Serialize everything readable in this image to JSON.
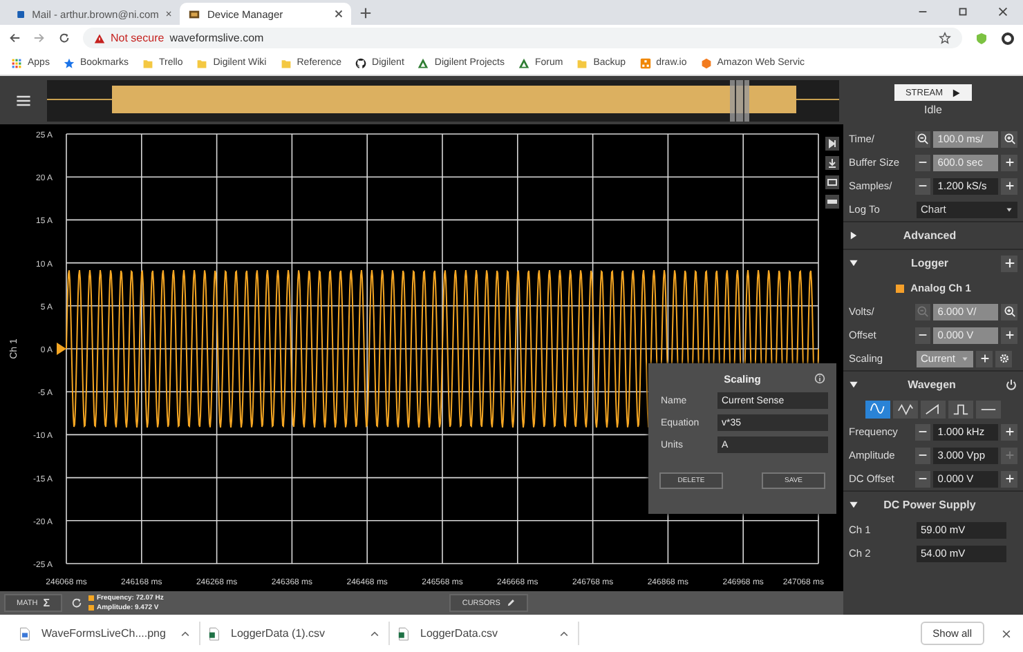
{
  "browser": {
    "tabs": [
      {
        "title": "Mail - arthur.brown@ni.com",
        "selected": false
      },
      {
        "title": "Device Manager",
        "selected": true
      }
    ],
    "address": {
      "warning": "Not secure",
      "url": "waveformslive.com"
    },
    "bookmarks": [
      {
        "kind": "apps",
        "label": "Apps"
      },
      {
        "kind": "star",
        "label": "Bookmarks"
      },
      {
        "kind": "folder",
        "label": "Trello"
      },
      {
        "kind": "folder",
        "label": "Digilent Wiki"
      },
      {
        "kind": "folder",
        "label": "Reference"
      },
      {
        "kind": "github",
        "label": "Digilent"
      },
      {
        "kind": "triangle",
        "label": "Digilent Projects"
      },
      {
        "kind": "triangle",
        "label": "Forum"
      },
      {
        "kind": "folder",
        "label": "Backup"
      },
      {
        "kind": "drawio",
        "label": "draw.io"
      },
      {
        "kind": "aws",
        "label": "Amazon Web Servic"
      }
    ],
    "downloads": [
      {
        "kind": "image",
        "name": "WaveFormsLiveCh....png"
      },
      {
        "kind": "sheet",
        "name": "LoggerData (1).csv"
      },
      {
        "kind": "sheet",
        "name": "LoggerData.csv"
      }
    ],
    "show_all": "Show all"
  },
  "chart": {
    "channel_label": "Ch 1",
    "y_ticks": [
      "25 A",
      "20 A",
      "15 A",
      "10 A",
      "5 A",
      "0 A",
      "-5 A",
      "-10 A",
      "-15 A",
      "-20 A",
      "-25 A"
    ],
    "x_ticks": [
      "246068 ms",
      "246168 ms",
      "246268 ms",
      "246368 ms",
      "246468 ms",
      "246568 ms",
      "246668 ms",
      "246768 ms",
      "246868 ms",
      "246968 ms",
      "247068 ms"
    ]
  },
  "status_bar": {
    "math": "MATH",
    "math_symbol": "Σ",
    "frequency": "Frequency: 72.07 Hz",
    "amplitude": "Amplitude: 9.472 V",
    "cursors": "CURSORS"
  },
  "scaling_dialog": {
    "title": "Scaling",
    "fields": [
      {
        "label": "Name",
        "value": "Current Sense"
      },
      {
        "label": "Equation",
        "value": "v*35"
      },
      {
        "label": "Units",
        "value": "A"
      }
    ],
    "buttons": [
      "DELETE",
      "SAVE"
    ]
  },
  "panel": {
    "stream_button": "STREAM",
    "status": "Idle",
    "acquisition": [
      {
        "kind": "zoom",
        "label": "Time/",
        "value": "100.0 ms/",
        "disabled": true,
        "decrease_disabled": false,
        "increase_disabled": false
      },
      {
        "kind": "stepper",
        "label": "Buffer Size",
        "value": "600.0 sec",
        "disabled": true,
        "decrease_disabled": false,
        "increase_disabled": false
      },
      {
        "kind": "stepper",
        "label": "Samples/",
        "value": "1.200 kS/s",
        "disabled": false,
        "decrease_disabled": false,
        "increase_disabled": false
      },
      {
        "kind": "select",
        "label": "Log To",
        "value": "Chart"
      }
    ],
    "advanced": {
      "title": "Advanced",
      "expanded": false
    },
    "logger": {
      "title": "Logger",
      "expanded": true,
      "channel": {
        "name": "Analog Ch 1",
        "color": "#f5a02a"
      },
      "rows": [
        {
          "kind": "zoom",
          "label": "Volts/",
          "value": "6.000 V/",
          "disabled": true,
          "decrease_disabled": true,
          "increase_disabled": false
        },
        {
          "kind": "stepper",
          "label": "Offset",
          "value": "0.000 V",
          "disabled": true,
          "decrease_disabled": false,
          "increase_disabled": false
        },
        {
          "kind": "scaling",
          "label": "Scaling",
          "value": "Current"
        }
      ]
    },
    "wavegen": {
      "title": "Wavegen",
      "expanded": true,
      "shapes": [
        {
          "kind": "sine",
          "selected": true
        },
        {
          "kind": "triangle",
          "selected": false
        },
        {
          "kind": "sawtooth",
          "selected": false
        },
        {
          "kind": "square",
          "selected": false
        },
        {
          "kind": "dc",
          "selected": false
        }
      ],
      "rows": [
        {
          "kind": "stepper",
          "label": "Frequency",
          "value": "1.000 kHz",
          "disabled": false,
          "decrease_disabled": false,
          "increase_disabled": false
        },
        {
          "kind": "stepper",
          "label": "Amplitude",
          "value": "3.000 Vpp",
          "disabled": false,
          "decrease_disabled": false,
          "increase_disabled": true
        },
        {
          "kind": "stepper",
          "label": "DC Offset",
          "value": "0.000 V",
          "disabled": false,
          "decrease_disabled": false,
          "increase_disabled": false
        }
      ]
    },
    "power_supply": {
      "title": "DC Power Supply",
      "expanded": true,
      "rows": [
        {
          "label": "Ch 1",
          "value": "59.00 mV"
        },
        {
          "label": "Ch 2",
          "value": "54.00 mV"
        }
      ]
    }
  }
}
